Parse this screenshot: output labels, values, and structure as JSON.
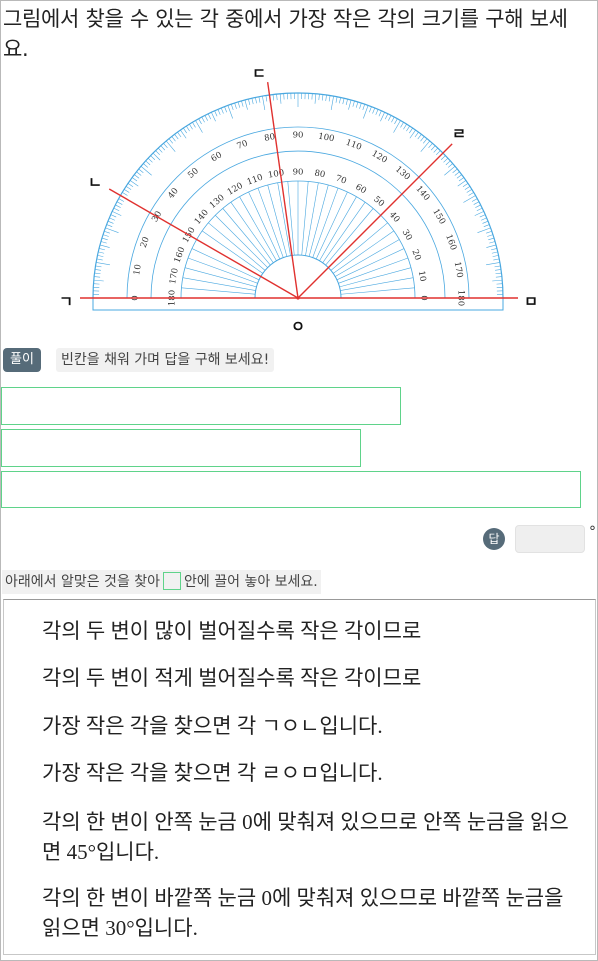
{
  "question": "그림에서 찾을 수 있는 각 중에서 가장 작은 각의 크기를 구해 보세요.",
  "figure": {
    "point_labels": {
      "g": "ㄱ",
      "n": "ㄴ",
      "d": "ㄷ",
      "r": "ㄹ",
      "m": "ㅁ",
      "o": "ㅇ"
    },
    "outer_scale": [
      "0",
      "10",
      "20",
      "30",
      "40",
      "50",
      "60",
      "70",
      "80",
      "90",
      "100",
      "110",
      "120",
      "130",
      "140",
      "150",
      "160",
      "170",
      "180"
    ],
    "inner_scale": [
      "180",
      "170",
      "160",
      "150",
      "140",
      "130",
      "120",
      "110",
      "100",
      "90",
      "80",
      "70",
      "60",
      "50",
      "40",
      "30",
      "20",
      "10",
      "0"
    ],
    "ray_angles_deg": {
      "n": 150,
      "d": 98,
      "r": 45
    },
    "colors": {
      "protractor": "#4aa8e0",
      "rays": "#e0312f"
    }
  },
  "solution": {
    "badge": "풀이",
    "hint": "빈칸을 채워 가며 답을 구해 보세요!"
  },
  "answer": {
    "badge": "답",
    "unit": "°",
    "value": ""
  },
  "drag_hint": {
    "before": "아래에서 알맞은 것을 찾아",
    "after": "안에 끌어 놓아 보세요."
  },
  "choices": [
    "각의 두 변이 많이 벌어질수록 작은 각이므로",
    "각의 두 변이 적게 벌어질수록 작은 각이므로",
    "가장 작은 각을 찾으면 각 ㄱㅇㄴ입니다.",
    "가장 작은 각을 찾으면 각 ㄹㅇㅁ입니다.",
    "각의 한 변이 안쪽 눈금 0에 맞춰져 있으므로 안쪽 눈금을 읽으면 45°입니다.",
    "각의 한 변이 바깥쪽 눈금 0에 맞춰져 있으므로 바깥쪽 눈금을 읽으면 30°입니다."
  ]
}
